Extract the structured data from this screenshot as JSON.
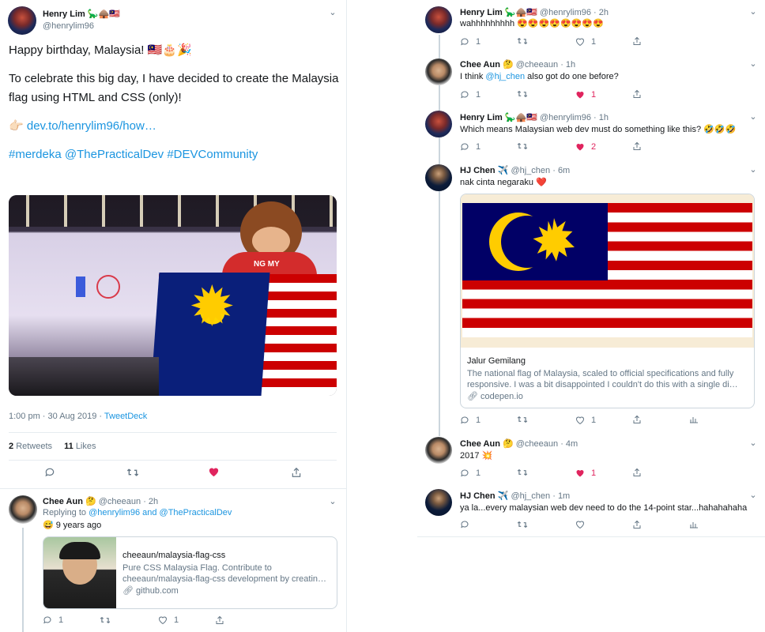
{
  "main_tweet": {
    "name": "Henry Lim",
    "handle": "@henrylim96",
    "emoji": "🦕🛖🇲🇾",
    "line1": "Happy birthday, Malaysia! 🇲🇾🎂🎉",
    "line2": "To celebrate this big day, I have decided to create the Malaysia flag using HTML and CSS (only)!",
    "link_emoji": "👉🏻",
    "link": "dev.to/henrylim96/how…",
    "hashtag1": "#merdeka",
    "mention": "@ThePracticalDev",
    "hashtag2": "#DEVCommunity",
    "photo_badge": "NG MY",
    "time": "1:00 pm · 30 Aug 2019 · ",
    "source": "TweetDeck",
    "retweets_count": "2",
    "retweets_label": "Retweets",
    "likes_count": "11",
    "likes_label": "Likes"
  },
  "reply_left": {
    "name": "Chee Aun",
    "emoji": "🤔",
    "handle": "@cheeaun",
    "time": "· 2h",
    "replying_prefix": "Replying to ",
    "replying_to": "@henrylim96 and @ThePracticalDev",
    "body": "😅 9 years ago",
    "card_title": "cheeaun/malaysia-flag-css",
    "card_desc": "Pure CSS Malaysia Flag. Contribute to cheeaun/malaysia-flag-css development by creatin…",
    "card_domain": "github.com",
    "reply_count": "1",
    "like_count": "1"
  },
  "thread": [
    {
      "name": "Henry Lim",
      "emoji": "🦕🛖🇲🇾",
      "handle": "@henrylim96",
      "time": "· 2h",
      "text": "wahhhhhhhhh 😍😍😍😍😍😍😍😍",
      "replies": "1",
      "likes": "1",
      "liked": false
    },
    {
      "name": "Chee Aun",
      "emoji": "🤔",
      "handle": "@cheeaun",
      "time": "· 1h",
      "text_pre": "I think ",
      "text_link": "@hj_chen",
      "text_post": " also got do one before?",
      "replies": "1",
      "likes": "1",
      "liked": true
    },
    {
      "name": "Henry Lim",
      "emoji": "🦕🛖🇲🇾",
      "handle": "@henrylim96",
      "time": "· 1h",
      "text": "Which means Malaysian web dev must do something like this? 🤣🤣🤣",
      "replies": "1",
      "likes": "2",
      "liked": true
    },
    {
      "name": "HJ Chen",
      "emoji": "✈️",
      "handle": "@hj_chen",
      "time": "· 6m",
      "text": "nak cinta negaraku ❤️",
      "replies": "1",
      "likes": "1",
      "liked": false,
      "card_title": "Jalur Gemilang",
      "card_desc": "The national flag of Malaysia, scaled to official specifications and fully responsive. I was a bit disappointed I couldn't do this with a single di…",
      "card_domain": "codepen.io"
    },
    {
      "name": "Chee Aun",
      "emoji": "🤔",
      "handle": "@cheeaun",
      "time": "· 4m",
      "text": "2017 💥",
      "replies": "1",
      "likes": "1",
      "liked": true
    },
    {
      "name": "HJ Chen",
      "emoji": "✈️",
      "handle": "@hj_chen",
      "time": "· 1m",
      "text": "ya la...every malaysian web dev need to do the 14-point star...hahahahaha",
      "replies": "",
      "likes": "",
      "liked": false
    }
  ],
  "colors": {
    "link": "#1b95e0",
    "like": "#e0245e",
    "muted": "#657786",
    "flag_red": "#cc0001",
    "flag_blue": "#010066",
    "flag_yellow": "#ffcc00"
  },
  "icons": [
    "reply-icon",
    "retweet-icon",
    "heart-icon",
    "share-icon",
    "analytics-icon",
    "chevron-down-icon",
    "link-icon"
  ]
}
